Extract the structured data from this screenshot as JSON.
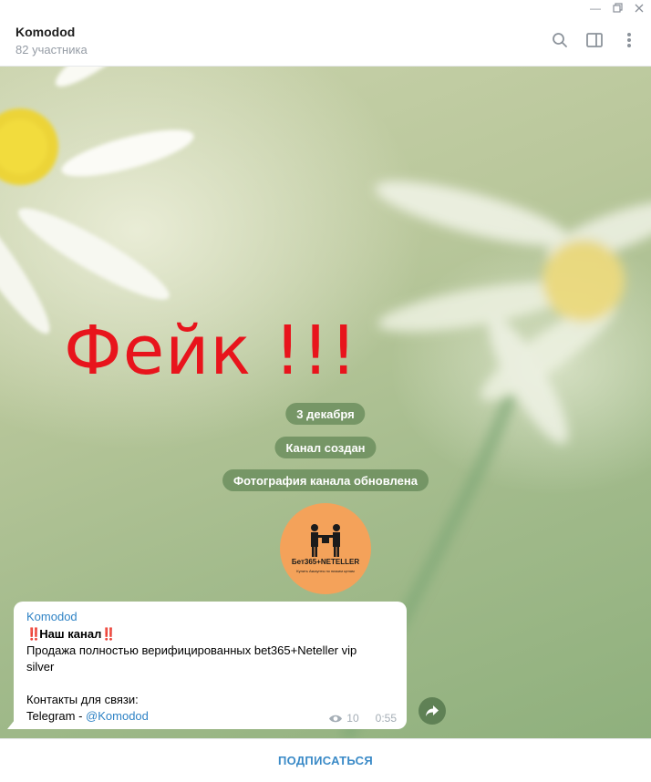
{
  "window": {
    "controls": [
      "minimize",
      "restore",
      "close"
    ]
  },
  "header": {
    "title": "Komodod",
    "subtitle": "82 участника",
    "icons": [
      "search-icon",
      "sidebar-toggle-icon",
      "more-vert-icon"
    ]
  },
  "chat": {
    "overlay_text": "Фейк !!!",
    "overlay_color": "#e8141c",
    "service_messages": [
      "3 декабря",
      "Канал создан",
      "Фотография канала обновлена"
    ],
    "channel_photo": {
      "logo_text": "Бет365+NETELLER",
      "tagline": "Купить Аккаунты по низким ценам",
      "bg_color": "#f4a25a"
    },
    "message": {
      "sender": "Komodod",
      "bang_prefix": "‼️",
      "heading": "Наш канал",
      "bang_suffix": "‼️",
      "line1": "Продажа полностью верифицированных bet365+Neteller vip",
      "line2": "silver",
      "line3": "",
      "line4": "Контакты для связи:",
      "line5_prefix": "Telegram - ",
      "line5_link": "@Komodod",
      "views": "10",
      "time": "0:55"
    }
  },
  "footer": {
    "subscribe_label": "ПОДПИСАТЬСЯ"
  },
  "colors": {
    "accent": "#3a8ac7",
    "sender": "#2f83c5",
    "pill_bg": "#6c8e5e"
  }
}
